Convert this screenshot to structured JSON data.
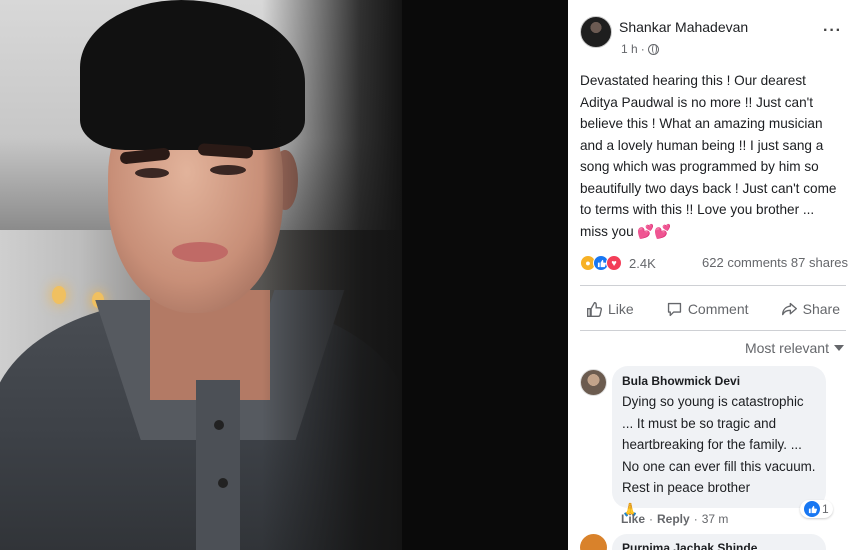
{
  "post": {
    "author": "Shankar Mahadevan",
    "time": "1 h",
    "more_icon": "···",
    "text": "Devastated hearing this ! Our dearest Aditya Paudwal is no more !! Just can't believe this ! What an amazing musician and a lovely human being !! I just sang a song which was programmed by him so beautifully two days back ! Just can't come to terms with this !! Love you brother ... miss you 💕💕",
    "reactions_count": "2.4K",
    "comments_count": "622 comments",
    "shares_count": "87 shares"
  },
  "actions": {
    "like": "Like",
    "comment": "Comment",
    "share": "Share"
  },
  "comments": {
    "sort_label": "Most relevant",
    "items": [
      {
        "name": "Bula Bhowmick Devi",
        "text": "Dying so young is catastrophic ... It must be so tragic and heartbreaking for the family. ... No one can ever fill this vacuum. Rest in peace brother",
        "emoji": "🙏",
        "like_label": "Like",
        "reply_label": "Reply",
        "time": "37 m",
        "like_count": "1"
      },
      {
        "name": "Purnima Jachak Shinde"
      }
    ]
  },
  "icons": {
    "reactions": [
      "sad-emoji-icon",
      "like-icon",
      "love-icon"
    ]
  },
  "colors": {
    "like_blue": "#1877f2",
    "love_red": "#f33e58",
    "sad_yellow": "#f7b125",
    "secondary_text": "#65676b"
  }
}
